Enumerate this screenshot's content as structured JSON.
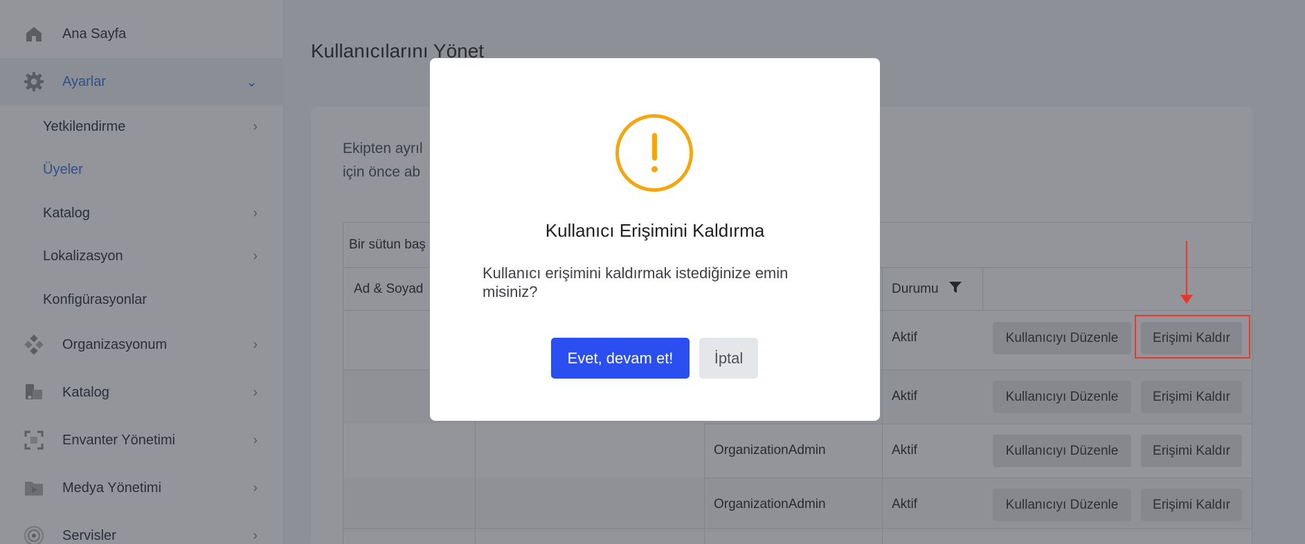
{
  "sidebar": {
    "items": [
      {
        "label": "Ana Sayfa",
        "icon": "home-icon"
      },
      {
        "label": "Ayarlar",
        "icon": "gear-icon"
      },
      {
        "label": "Organizasyonum",
        "icon": "organization-icon"
      },
      {
        "label": "Katalog",
        "icon": "catalog-icon"
      },
      {
        "label": "Envanter Yönetimi",
        "icon": "inventory-icon"
      },
      {
        "label": "Medya Yönetimi",
        "icon": "media-icon"
      },
      {
        "label": "Servisler",
        "icon": "services-icon"
      }
    ],
    "subitems": [
      {
        "label": "Yetkilendirme"
      },
      {
        "label": "Üyeler"
      },
      {
        "label": "Katalog"
      },
      {
        "label": "Lokalizasyon"
      },
      {
        "label": "Konfigürasyonlar"
      }
    ]
  },
  "main": {
    "title": "Kullanıcılarını Yönet",
    "description": "Ekipten ayrıl için önce ab",
    "group_bar": "Bir sütun baş",
    "columns": {
      "name": "Ad & Soyad",
      "status": "Durumu"
    },
    "rows": [
      {
        "role": "",
        "status": "Aktif",
        "edit": "Kullanıcıyı Düzenle",
        "remove": "Erişimi Kaldır"
      },
      {
        "role": "",
        "status": "Aktif",
        "edit": "Kullanıcıyı Düzenle",
        "remove": "Erişimi Kaldır"
      },
      {
        "role": "OrganizationAdmin",
        "status": "Aktif",
        "edit": "Kullanıcıyı Düzenle",
        "remove": "Erişimi Kaldır"
      },
      {
        "role": "OrganizationAdmin",
        "status": "Aktif",
        "edit": "Kullanıcıyı Düzenle",
        "remove": "Erişimi Kaldır"
      }
    ]
  },
  "modal": {
    "icon": "warning-icon",
    "title": "Kullanıcı Erişimini Kaldırma",
    "message": "Kullanıcı erişimini kaldırmak istediğinize emin misiniz?",
    "confirm": "Evet, devam et!",
    "cancel": "İptal"
  },
  "colors": {
    "accent": "#3b73d9",
    "confirm": "#2b4ef0",
    "warning": "#f4a60f",
    "annotation": "#e8382c"
  }
}
